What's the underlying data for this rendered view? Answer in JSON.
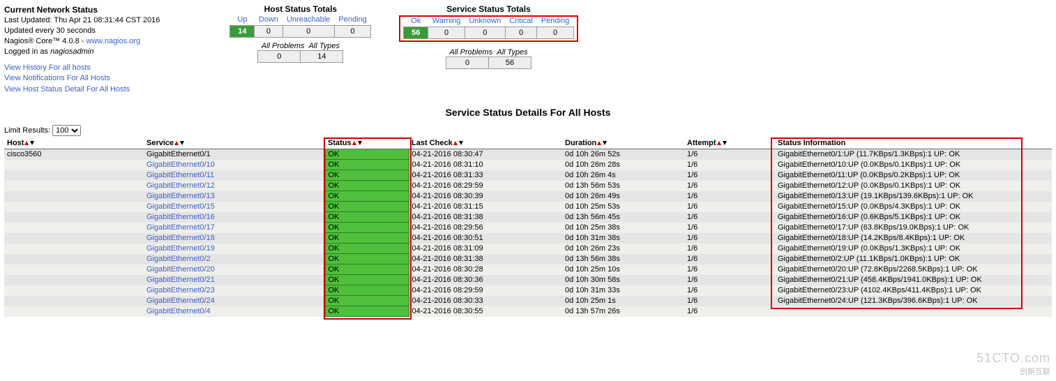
{
  "header": {
    "title": "Current Network Status",
    "last_updated": "Last Updated: Thu Apr 21 08:31:44 CST 2016",
    "update_every": "Updated every 30 seconds",
    "core_prefix": "Nagios® Core™ 4.0.8 - ",
    "core_link": "www.nagios.org",
    "logged_in_prefix": "Logged in as ",
    "logged_in_user": "nagiosadmin",
    "links": {
      "history": "View History For all hosts",
      "notifications": "View Notifications For All Hosts",
      "detail": "View Host Status Detail For All Hosts"
    }
  },
  "host_totals": {
    "title": "Host Status Totals",
    "headers": {
      "up": "Up",
      "down": "Down",
      "unreachable": "Unreachable",
      "pending": "Pending"
    },
    "values": {
      "up": "14",
      "down": "0",
      "unreachable": "0",
      "pending": "0"
    },
    "problem_labels": {
      "problems": "All Problems",
      "types": "All Types"
    },
    "problem_values": {
      "problems": "0",
      "types": "14"
    }
  },
  "service_totals": {
    "title": "Service Status Totals",
    "headers": {
      "ok": "Ok",
      "warning": "Warning",
      "unknown": "Unknown",
      "critical": "Critical",
      "pending": "Pending"
    },
    "values": {
      "ok": "56",
      "warning": "0",
      "unknown": "0",
      "critical": "0",
      "pending": "0"
    },
    "problem_labels": {
      "problems": "All Problems",
      "types": "All Types"
    },
    "problem_values": {
      "problems": "0",
      "types": "56"
    }
  },
  "page_title": "Service Status Details For All Hosts",
  "limit": {
    "label": "Limit Results:",
    "value": "100"
  },
  "columns": {
    "host": "Host",
    "service": "Service",
    "status": "Status",
    "last_check": "Last Check",
    "duration": "Duration",
    "attempt": "Attempt",
    "info": "Status Information"
  },
  "host_name": "cisco3560",
  "rows": [
    {
      "service": "GigabitEthernet0/1",
      "status": "OK",
      "last": "04-21-2016 08:30:47",
      "dur": "0d 10h 26m 52s",
      "att": "1/6",
      "info": "GigabitEthernet0/1:UP (11.7KBps/1.3KBps):1 UP: OK"
    },
    {
      "service": "GigabitEthernet0/10",
      "status": "OK",
      "last": "04-21-2016 08:31:10",
      "dur": "0d 10h 26m 28s",
      "att": "1/6",
      "info": "GigabitEthernet0/10:UP (0.0KBps/0.1KBps):1 UP: OK"
    },
    {
      "service": "GigabitEthernet0/11",
      "status": "OK",
      "last": "04-21-2016 08:31:33",
      "dur": "0d 10h 26m 4s",
      "att": "1/6",
      "info": "GigabitEthernet0/11:UP (0.0KBps/0.2KBps):1 UP: OK"
    },
    {
      "service": "GigabitEthernet0/12",
      "status": "OK",
      "last": "04-21-2016 08:29:59",
      "dur": "0d 13h 56m 53s",
      "att": "1/6",
      "info": "GigabitEthernet0/12:UP (0.0KBps/0.1KBps):1 UP: OK"
    },
    {
      "service": "GigabitEthernet0/13",
      "status": "OK",
      "last": "04-21-2016 08:30:39",
      "dur": "0d 10h 26m 49s",
      "att": "1/6",
      "info": "GigabitEthernet0/13:UP (19.1KBps/139.6KBps):1 UP: OK"
    },
    {
      "service": "GigabitEthernet0/15",
      "status": "OK",
      "last": "04-21-2016 08:31:15",
      "dur": "0d 10h 25m 53s",
      "att": "1/6",
      "info": "GigabitEthernet0/15:UP (0.0KBps/4.3KBps):1 UP: OK"
    },
    {
      "service": "GigabitEthernet0/16",
      "status": "OK",
      "last": "04-21-2016 08:31:38",
      "dur": "0d 13h 56m 45s",
      "att": "1/6",
      "info": "GigabitEthernet0/16:UP (0.6KBps/5.1KBps):1 UP: OK"
    },
    {
      "service": "GigabitEthernet0/17",
      "status": "OK",
      "last": "04-21-2016 08:29:56",
      "dur": "0d 10h 25m 38s",
      "att": "1/6",
      "info": "GigabitEthernet0/17:UP (63.8KBps/19.0KBps):1 UP: OK"
    },
    {
      "service": "GigabitEthernet0/18",
      "status": "OK",
      "last": "04-21-2016 08:30:51",
      "dur": "0d 10h 31m 38s",
      "att": "1/6",
      "info": "GigabitEthernet0/18:UP (14.2KBps/8.4KBps):1 UP: OK"
    },
    {
      "service": "GigabitEthernet0/19",
      "status": "OK",
      "last": "04-21-2016 08:31:09",
      "dur": "0d 10h 26m 23s",
      "att": "1/6",
      "info": "GigabitEthernet0/19:UP (0.0KBps/1.3KBps):1 UP: OK"
    },
    {
      "service": "GigabitEthernet0/2",
      "status": "OK",
      "last": "04-21-2016 08:31:38",
      "dur": "0d 13h 56m 38s",
      "att": "1/6",
      "info": "GigabitEthernet0/2:UP (11.1KBps/1.0KBps):1 UP: OK"
    },
    {
      "service": "GigabitEthernet0/20",
      "status": "OK",
      "last": "04-21-2016 08:30:28",
      "dur": "0d 10h 25m 10s",
      "att": "1/6",
      "info": "GigabitEthernet0/20:UP (72.8KBps/2268.5KBps):1 UP: OK"
    },
    {
      "service": "GigabitEthernet0/21",
      "status": "OK",
      "last": "04-21-2016 08:30:36",
      "dur": "0d 10h 30m 58s",
      "att": "1/6",
      "info": "GigabitEthernet0/21:UP (458.4KBps/1941.0KBps):1 UP: OK"
    },
    {
      "service": "GigabitEthernet0/23",
      "status": "OK",
      "last": "04-21-2016 08:29:59",
      "dur": "0d 10h 31m 33s",
      "att": "1/6",
      "info": "GigabitEthernet0/23:UP (4102.4KBps/411.4KBps):1 UP: OK"
    },
    {
      "service": "GigabitEthernet0/24",
      "status": "OK",
      "last": "04-21-2016 08:30:33",
      "dur": "0d 10h 25m 1s",
      "att": "1/6",
      "info": "GigabitEthernet0/24:UP (121.3KBps/396.6KBps):1 UP: OK"
    },
    {
      "service": "GigabitEthernet0/4",
      "status": "OK",
      "last": "04-21-2016 08:30:55",
      "dur": "0d 13h 57m 26s",
      "att": "1/6",
      "info": ""
    }
  ],
  "watermark": {
    "main": "51CTO.com",
    "sub": "创新互联"
  }
}
